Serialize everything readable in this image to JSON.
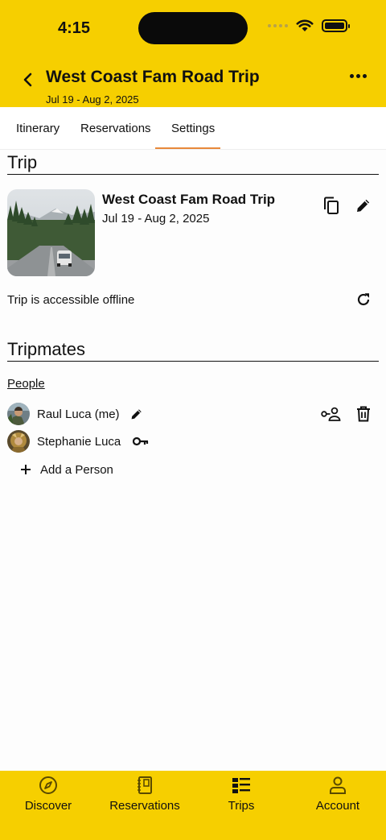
{
  "status": {
    "time": "4:15"
  },
  "header": {
    "title": "West Coast Fam Road Trip",
    "dates": "Jul 19 - Aug 2, 2025"
  },
  "tabs": [
    {
      "label": "Itinerary"
    },
    {
      "label": "Reservations"
    },
    {
      "label": "Settings"
    }
  ],
  "trip_section": {
    "heading": "Trip",
    "name": "West Coast Fam Road Trip",
    "dates": "Jul 19 - Aug 2, 2025",
    "offline_text": "Trip is accessible offline"
  },
  "tripmates_section": {
    "heading": "Tripmates",
    "people_label": "People",
    "people": [
      {
        "name": "Raul Luca (me)"
      },
      {
        "name": "Stephanie Luca"
      }
    ],
    "add_label": "Add a Person"
  },
  "bottom_nav": [
    {
      "label": "Discover",
      "icon": "compass-icon"
    },
    {
      "label": "Reservations",
      "icon": "notebook-icon"
    },
    {
      "label": "Trips",
      "icon": "trips-list-icon"
    },
    {
      "label": "Account",
      "icon": "person-icon"
    }
  ],
  "colors": {
    "brand_yellow": "#f6cf00",
    "tab_accent": "#e8893a"
  }
}
